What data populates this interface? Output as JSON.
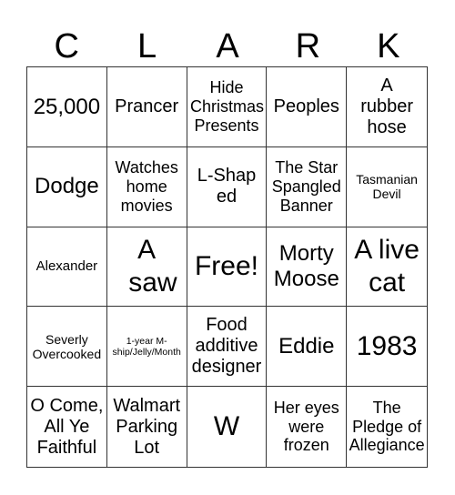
{
  "card": {
    "title_letters": [
      "C",
      "L",
      "A",
      "R",
      "K"
    ],
    "cells": [
      {
        "text": "25,000",
        "size": "lg"
      },
      {
        "text": "Prancer",
        "size": "md"
      },
      {
        "text": "Hide Christmas Presents",
        "size": "sm"
      },
      {
        "text": "Peoples",
        "size": "md"
      },
      {
        "text": "A rubber hose",
        "size": "md"
      },
      {
        "text": "Dodge",
        "size": "lg"
      },
      {
        "text": "Watches home movies",
        "size": "sm"
      },
      {
        "text": "L-Shaped",
        "size": "md"
      },
      {
        "text": "The Star Spangled Banner",
        "size": "sm"
      },
      {
        "text": "Tasmanian Devil",
        "size": "xxs"
      },
      {
        "text": "Alexander",
        "size": "xs"
      },
      {
        "text": "A saw",
        "size": "xl"
      },
      {
        "text": "Free!",
        "size": "free"
      },
      {
        "text": "Morty Moose",
        "size": "lg"
      },
      {
        "text": "A live cat",
        "size": "xl"
      },
      {
        "text": "Severly Overcooked",
        "size": "xxs"
      },
      {
        "text": "1-year M-ship/Jelly/Month",
        "size": "tiny"
      },
      {
        "text": "Food additive designer",
        "size": "md"
      },
      {
        "text": "Eddie",
        "size": "lg"
      },
      {
        "text": "1983",
        "size": "xl"
      },
      {
        "text": "O Come, All Ye Faithful",
        "size": "md"
      },
      {
        "text": "Walmart Parking Lot",
        "size": "md"
      },
      {
        "text": "W",
        "size": "xl"
      },
      {
        "text": "Her eyes were frozen",
        "size": "sm"
      },
      {
        "text": "The Pledge of Allegiance",
        "size": "sm"
      }
    ]
  }
}
